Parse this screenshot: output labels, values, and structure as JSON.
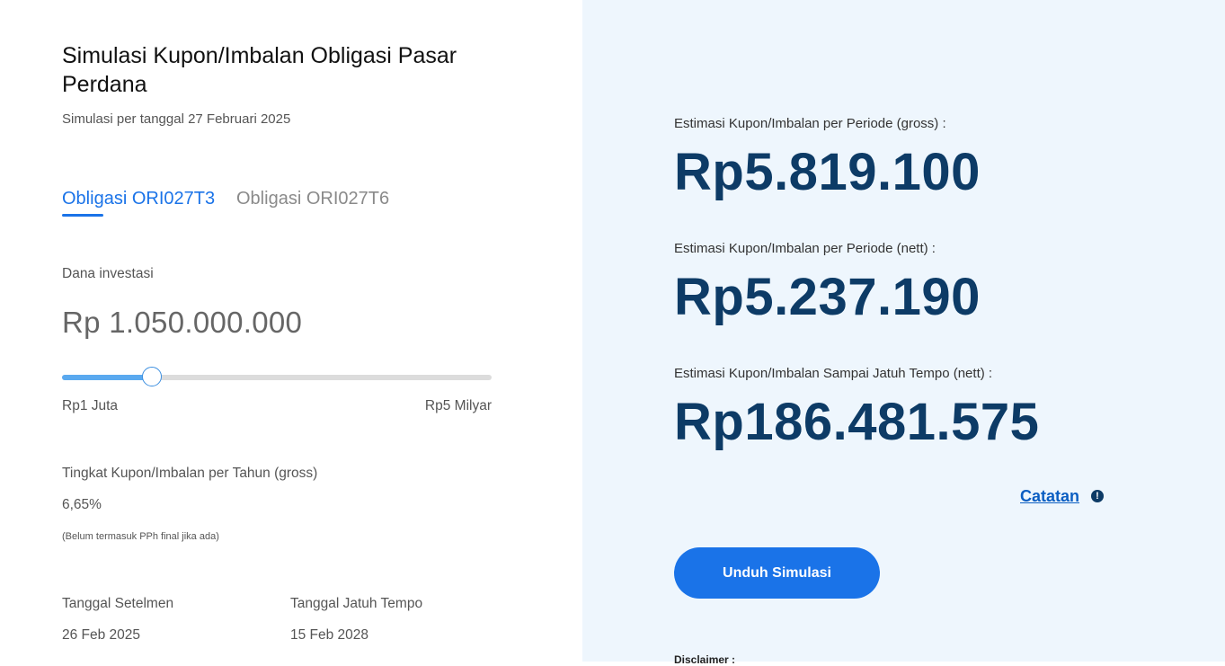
{
  "header": {
    "title": "Simulasi Kupon/Imbalan Obligasi Pasar Perdana",
    "subtitle": "Simulasi per tanggal 27 Februari 2025"
  },
  "tabs": [
    {
      "label": "Obligasi ORI027T3",
      "active": true
    },
    {
      "label": "Obligasi ORI027T6",
      "active": false
    }
  ],
  "investment": {
    "label": "Dana investasi",
    "currency": "Rp",
    "amount": "1.050.000.000",
    "slider": {
      "min_label": "Rp1 Juta",
      "max_label": "Rp5 Milyar",
      "fraction": 0.21
    }
  },
  "coupon_rate": {
    "label": "Tingkat Kupon/Imbalan per Tahun (gross)",
    "value": "6,65%",
    "note": "(Belum termasuk PPh final jika ada)"
  },
  "dates": {
    "settlement_label": "Tanggal Setelmen",
    "settlement_value": "26 Feb 2025",
    "maturity_label": "Tanggal Jatuh Tempo",
    "maturity_value": "15 Feb 2028"
  },
  "results": {
    "gross_label": "Estimasi Kupon/Imbalan per Periode (gross) :",
    "gross_value": "Rp5.819.100",
    "nett_label": "Estimasi Kupon/Imbalan per Periode (nett) :",
    "nett_value": "Rp5.237.190",
    "total_label": "Estimasi Kupon/Imbalan Sampai Jatuh Tempo (nett) :",
    "total_value": "Rp186.481.575"
  },
  "notes": {
    "catatan_label": "Catatan",
    "icon": "info-icon"
  },
  "actions": {
    "download_label": "Unduh Simulasi"
  },
  "disclaimer": {
    "label": "Disclaimer :"
  },
  "colors": {
    "accent": "#1a73e8",
    "value_dark": "#0d3b66",
    "panel_bg": "#eef6fd"
  }
}
